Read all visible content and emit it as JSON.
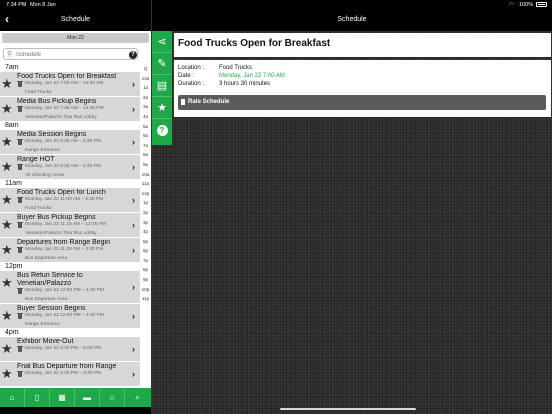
{
  "status_bar": {
    "time": "7:34 PM",
    "date": "Mon 8 Jan",
    "battery": "100%"
  },
  "left_header": {
    "title": "Schedule",
    "back": "‹"
  },
  "right_header": {
    "title": "Schedule"
  },
  "date_tab": "Mon 22",
  "search": {
    "placeholder": "Schedule",
    "help": "?"
  },
  "list": [
    {
      "hour": "7am"
    },
    {
      "title": "Food Trucks Open for Breakfast",
      "time": "Monday, Jan 22 7:00 AM – 10:30 AM",
      "location": "Food Trucks"
    },
    {
      "title": "Media Bus Pickup Begins",
      "time": "Monday, Jan 22 7:45 AM – 12:45 PM",
      "location": "Venetian/Palazzo Tour Bus Lobby"
    },
    {
      "hour": "8am"
    },
    {
      "title": "Media Session Begins",
      "time": "Monday, Jan 22 8:30 AM – 4:30 PM",
      "location": "Range Entrance"
    },
    {
      "title": "Range HOT",
      "time": "Monday, Jan 22 8:30 AM – 4:30 PM",
      "location": "All Shooting Areas"
    },
    {
      "hour": "11am"
    },
    {
      "title": "Food Trucks Open for Lunch",
      "time": "Monday, Jan 22 11:00 AM – 2:30 PM",
      "location": "Food Trucks"
    },
    {
      "title": "Buyer Bus Pickup Begins",
      "time": "Monday, Jan 22 11:15 AM – 12:45 PM",
      "location": "Venetian/Palazzo Tour Bus Lobby"
    },
    {
      "title": "Departures from Range Begin",
      "time": "Monday, Jan 22 11:30 AM – 4:30 PM",
      "location": "Bus Departure Area"
    },
    {
      "hour": "12pm"
    },
    {
      "title": "Bus Retun Service to Venetian/Palazzo",
      "time": "Monday, Jan 22 12:00 PM – 4:30 PM",
      "location": "Bus Departure Area",
      "tall": true
    },
    {
      "title": "Buyer Session Begins",
      "time": "Monday, Jan 22 12:00 PM – 4:30 PM",
      "location": "Range Entrance"
    },
    {
      "hour": "4pm"
    },
    {
      "title": "Exhibor Move-Out",
      "time": "Monday, Jan 22 4:30 PM – 6:00 PM",
      "location": ""
    },
    {
      "title": "Fnal Bus Departure from Range",
      "time": "Monday, Jan 22 4:30 PM – 6:30 PM",
      "location": ""
    }
  ],
  "index": [
    "Q",
    "12a",
    "1a",
    "2a",
    "3a",
    "4a",
    "5a",
    "6a",
    "7a",
    "8a",
    "9a",
    "10a",
    "11a",
    "12p",
    "1p",
    "2p",
    "3p",
    "4p",
    "5p",
    "6p",
    "7p",
    "8p",
    "9p",
    "10p",
    "11p"
  ],
  "tabbar": [
    {
      "name": "home-tab",
      "icon": "⌂"
    },
    {
      "name": "phone-tab",
      "icon": "▯"
    },
    {
      "name": "calendar-tab",
      "icon": "▦"
    },
    {
      "name": "bus-tab",
      "icon": "▬"
    },
    {
      "name": "favorites-tab",
      "icon": "☆"
    },
    {
      "name": "search-tab",
      "icon": "⌕"
    }
  ],
  "detail": {
    "title": "Food Trucks Open for Breakfast",
    "location_label": "Location :",
    "location": "Food Trucks",
    "date_label": "Date :",
    "date": "Monday, Jan 22 7:00 AM",
    "duration_label": "Duration :",
    "duration": "3 hours 30 minutes",
    "rate_button": "Rate Schedule"
  },
  "colors": {
    "accent": "#1fa84a",
    "green_text": "#2fa44f",
    "event_bg": "#d7d7d7"
  }
}
